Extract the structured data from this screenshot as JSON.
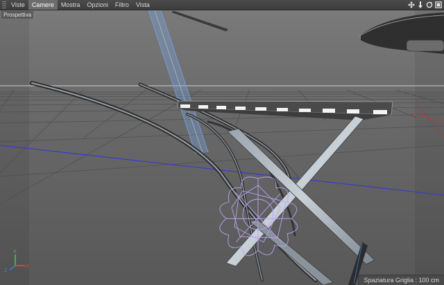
{
  "menu": {
    "items": [
      {
        "label": "Viste",
        "active": false
      },
      {
        "label": "Camere",
        "active": true
      },
      {
        "label": "Mostra",
        "active": false
      },
      {
        "label": "Opzioni",
        "active": false
      },
      {
        "label": "Filtro",
        "active": false
      },
      {
        "label": "Vista",
        "active": false
      }
    ]
  },
  "nav_icons": [
    "move-view-icon",
    "dolly-view-icon",
    "rotate-view-icon",
    "maximize-view-icon"
  ],
  "viewport": {
    "view_label": "Prospettiva",
    "grid_spacing": "Spaziatura Griglia : 100 cm",
    "axis_labels": {
      "x": "X",
      "y": "Y",
      "z": "Z"
    }
  },
  "colors": {
    "viewport_bg": "#5a5a5a",
    "horizon": "#c9c9c9",
    "world_x_axis": "#3a3acc",
    "world_z_axis": "#c23a3a",
    "selection_outline": "#b8a4f5",
    "camera_frustum": "#6f9fd8",
    "axis_gizmo_x": "#e0473a",
    "axis_gizmo_y": "#3ad04a",
    "axis_gizmo_z": "#3d7fe0"
  }
}
